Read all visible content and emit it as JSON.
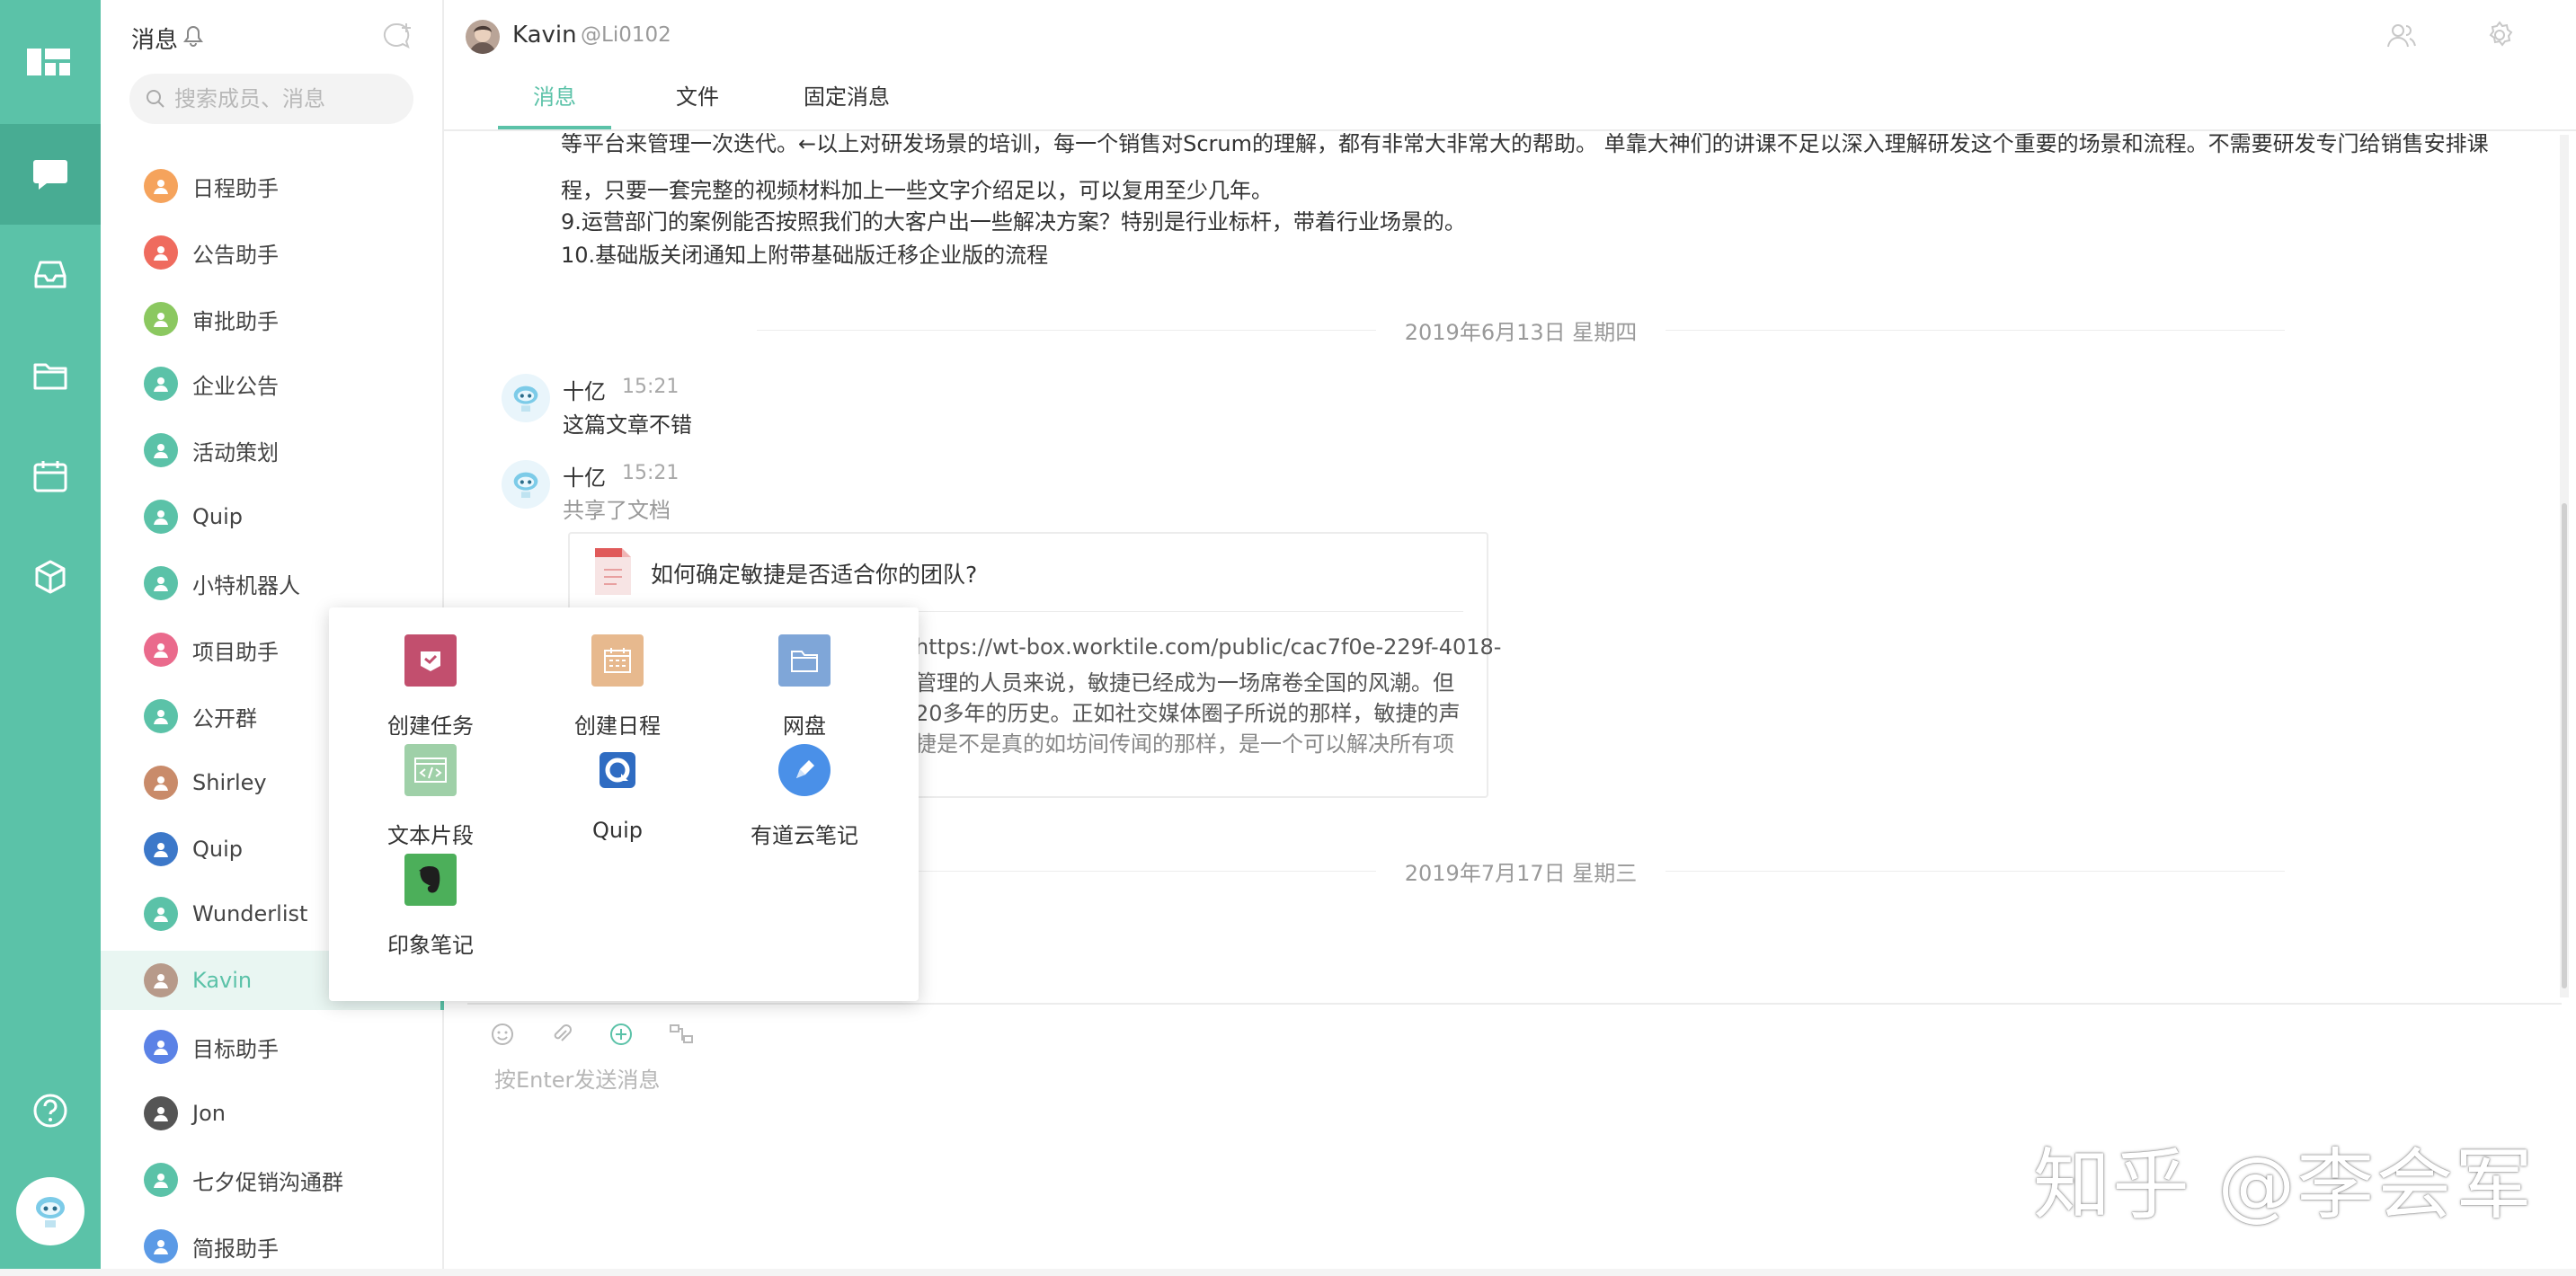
{
  "rail": {
    "items": [
      "apps-icon",
      "chat-icon",
      "inbox-icon",
      "folder-icon",
      "calendar-icon",
      "cube-icon",
      "help-icon",
      "avatar-robot"
    ]
  },
  "sidebar": {
    "title": "消息",
    "search_placeholder": "搜索成员、消息",
    "items": [
      {
        "label": "日程助手",
        "color": "#f5a35c"
      },
      {
        "label": "公告助手",
        "color": "#ef6b5e"
      },
      {
        "label": "审批助手",
        "color": "#8bc860"
      },
      {
        "label": "企业公告",
        "color": "#5bc2a8"
      },
      {
        "label": "活动策划",
        "color": "#5bc2a8"
      },
      {
        "label": "Quip",
        "color": "#5bc2a8"
      },
      {
        "label": "小特机器人",
        "color": "#5bc2a8"
      },
      {
        "label": "项目助手",
        "color": "#ea6a8c"
      },
      {
        "label": "公开群",
        "color": "#5bc2a8"
      },
      {
        "label": "Shirley",
        "color": "#c98b6a"
      },
      {
        "label": "Quip",
        "color": "#3c78c9"
      },
      {
        "label": "Wunderlist",
        "color": "#5bc2a8"
      },
      {
        "label": "Kavin",
        "color": "#b79a8a"
      },
      {
        "label": "目标助手",
        "color": "#5b82e6"
      },
      {
        "label": "Jon",
        "color": "#555555"
      },
      {
        "label": "七夕促销沟通群",
        "color": "#5bc2a8"
      },
      {
        "label": "简报助手",
        "color": "#5b9ae6"
      }
    ]
  },
  "header": {
    "name": "Kavin",
    "handle": "@Li0102",
    "tabs": [
      "消息",
      "文件",
      "固定消息"
    ]
  },
  "messages": {
    "lines_top": [
      "等平台来管理一次迭代。←以上对研发场景的培训，每一个销售对Scrum的理解，都有非常大非常大的帮助。 单靠大神们的讲课不足以深入理解研发这个重要的场景和流程。不需要研发专门给销售安排课",
      "程，只要一套完整的视频材料加上一些文字介绍足以，可以复用至少几年。",
      "9.运营部门的案例能否按照我们的大客户出一些解决方案？特别是行业标杆，带着行业场景的。",
      "10.基础版关闭通知上附带基础版迁移企业版的流程"
    ],
    "date1": "2019年6月13日 星期四",
    "msg1": {
      "sender": "十亿",
      "time": "15:21",
      "text": "这篇文章不错"
    },
    "msg2": {
      "sender": "十亿",
      "time": "15:21",
      "subtitle": "共享了文档"
    },
    "doc": {
      "title": "如何确定敏捷是否适合你的团队?",
      "lines": [
        "https://wt-box.worktile.com/public/cac7f0e-229f-4018-",
        "管理的人员来说，敏捷已经成为一场席卷全国的风潮。但",
        "20多年的历史。正如社交媒体圈子所说的那样，敏捷的声",
        "捷是不是真的如坊间传闻的那样，是一个可以解决所有项"
      ]
    },
    "date2": "2019年7月17日 星期三"
  },
  "composer": {
    "placeholder": "按Enter发送消息"
  },
  "popup": {
    "apps": [
      {
        "label": "创建任务",
        "color": "#c24f6e",
        "icon": "task-icon"
      },
      {
        "label": "创建日程",
        "color": "#e7b98e",
        "icon": "schedule-icon"
      },
      {
        "label": "网盘",
        "color": "#7fa6d8",
        "icon": "drive-icon"
      },
      {
        "label": "文本片段",
        "color": "#9fd0a8",
        "icon": "snippet-icon"
      },
      {
        "label": "Quip",
        "color": "#2f6cc2",
        "icon": "quip-icon"
      },
      {
        "label": "有道云笔记",
        "color": "#4a90e8",
        "icon": "youdao-icon"
      },
      {
        "label": "印象笔记",
        "color": "#4caf5a",
        "icon": "evernote-icon"
      }
    ]
  },
  "watermark": "知乎 @李会军"
}
